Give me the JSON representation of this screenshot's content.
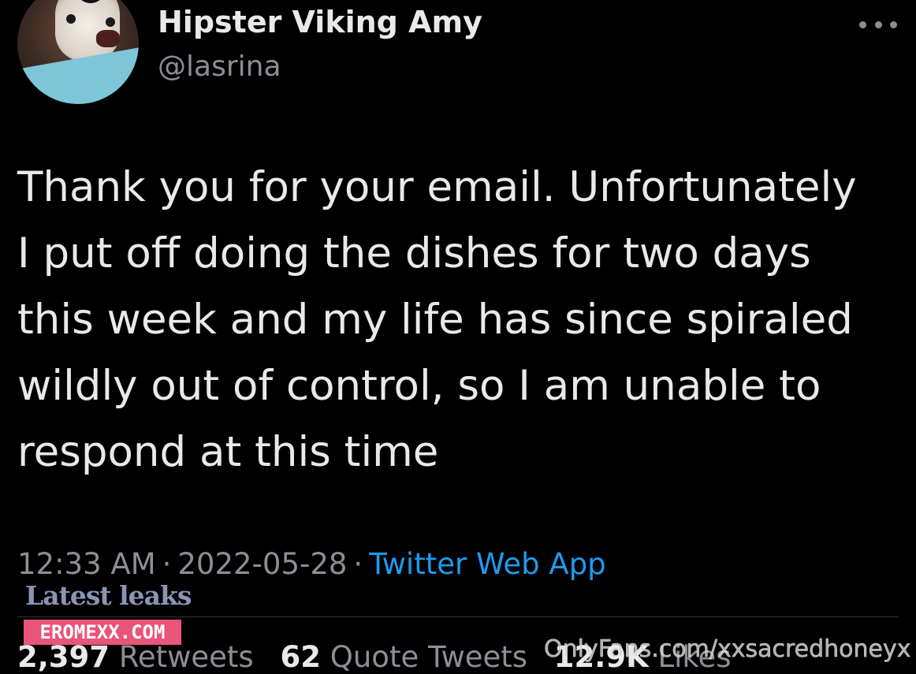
{
  "user": {
    "display_name": "Hipster Viking Amy",
    "handle": "@lasrina",
    "avatar_icon": "dog-avatar"
  },
  "tweet": {
    "lines": [
      "Thank you for your email. Unfortunately",
      "I put off doing the dishes for two days",
      "this week and my life has since spiraled",
      "wildly out of control, so I am unable to",
      "respond at this time"
    ]
  },
  "meta": {
    "time": "12:33 AM",
    "separator": "·",
    "date": "2022-05-28",
    "source": "Twitter Web App"
  },
  "stats": {
    "retweets_count": "2,397",
    "retweets_label": "Retweets",
    "quotes_count": "62",
    "quotes_label": "Quote Tweets",
    "likes_count": "12.9K",
    "likes_label": "Likes"
  },
  "watermarks": {
    "latest_leaks": "Latest leaks",
    "site": "EROMEXX.COM",
    "onlyfans": "OnlyFans.com/xxsacredhoneyx"
  },
  "colors": {
    "background": "#000000",
    "text": "#e7e9ea",
    "muted": "#8b8f94",
    "link": "#1d9bf0",
    "watermark_pink": "#e8547a"
  }
}
